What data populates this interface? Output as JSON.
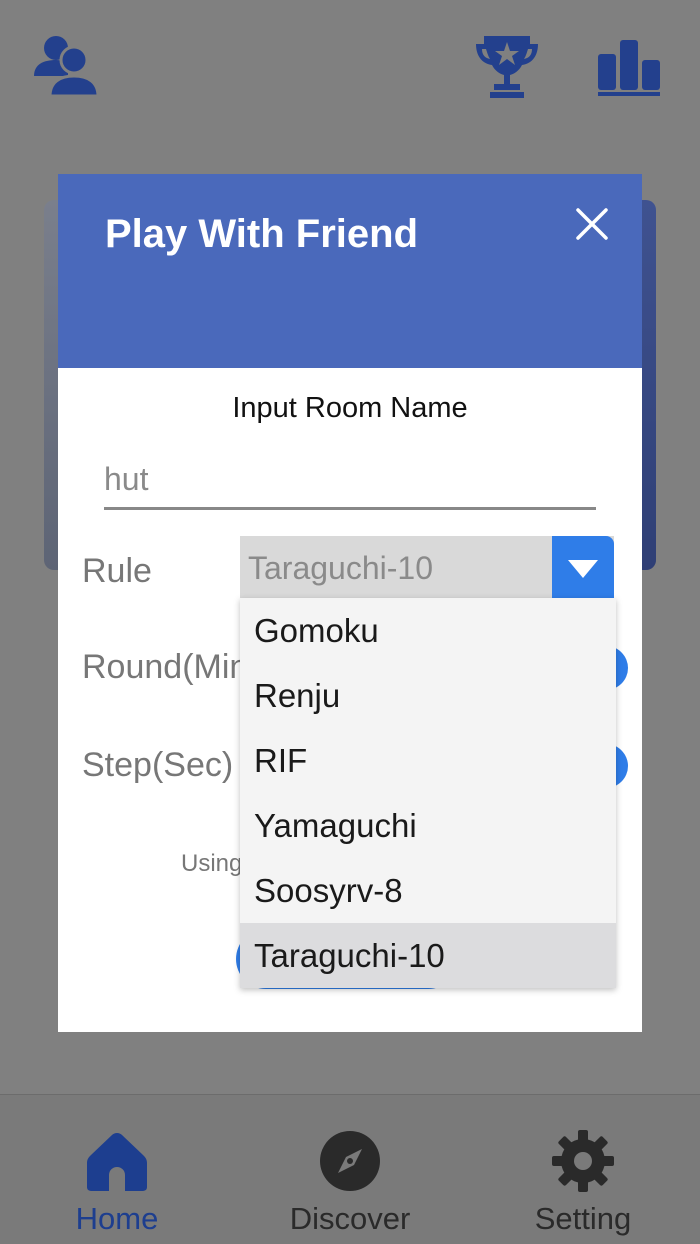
{
  "colors": {
    "overlay": "#808080",
    "modal_header": "#4a69bb",
    "accent_blue": "#2f7de8",
    "icon_blue": "#23408d",
    "nav_active": "#1d3e8f",
    "nav_inactive": "#2a2a2a"
  },
  "top_bar": {
    "profile_icon": "users-icon",
    "trophy_icon": "trophy-icon",
    "leaderboard_icon": "bar-chart-icon"
  },
  "modal": {
    "title": "Play With Friend",
    "close_icon": "close-icon",
    "room_label": "Input Room Name",
    "room_value": "hut",
    "rule_label": "Rule",
    "round_label": "Round(Min)",
    "step_label": "Step(Sec)",
    "using_text": "Using",
    "rule_select": {
      "value": "Taraguchi-10",
      "arrow_icon": "triangle-down-icon",
      "options": [
        "Gomoku",
        "Renju",
        "RIF",
        "Yamaguchi",
        "Soosyrv-8",
        "Taraguchi-10"
      ],
      "selected_index": 5
    }
  },
  "bottom_nav": {
    "items": [
      {
        "label": "Home",
        "icon": "home-icon",
        "active": true
      },
      {
        "label": "Discover",
        "icon": "compass-icon",
        "active": false
      },
      {
        "label": "Setting",
        "icon": "gear-icon",
        "active": false
      }
    ]
  }
}
